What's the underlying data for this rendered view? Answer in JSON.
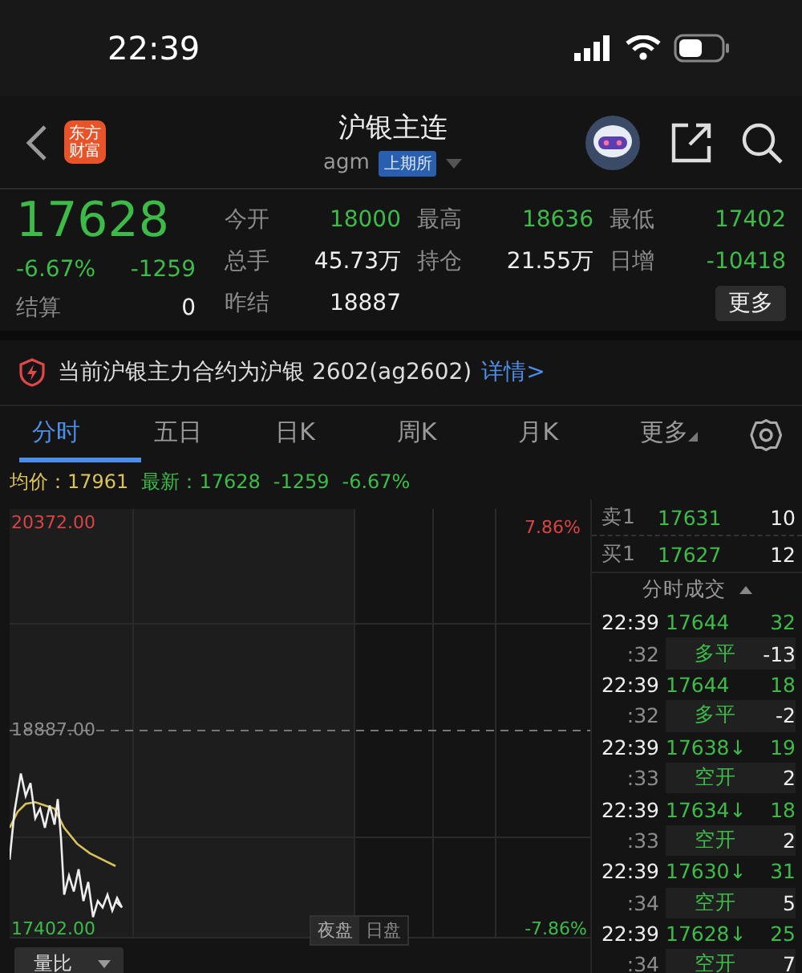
{
  "status_bar": {
    "time": "22:39"
  },
  "header": {
    "logo_lines": [
      "东方",
      "财富"
    ],
    "title": "沪银主连",
    "code": "agm",
    "exchange": "上期所"
  },
  "quote": {
    "price": "17628",
    "change_pct": "-6.67%",
    "change": "-1259",
    "settle_label": "结算",
    "settle": "0",
    "stats": [
      {
        "label": "今开",
        "value": "18000",
        "kind": "price"
      },
      {
        "label": "最高",
        "value": "18636",
        "kind": "price"
      },
      {
        "label": "最低",
        "value": "17402",
        "kind": "price"
      },
      {
        "label": "总手",
        "value": "45.73万",
        "kind": "plain"
      },
      {
        "label": "持仓",
        "value": "21.55万",
        "kind": "plain"
      },
      {
        "label": "日增",
        "value": "-10418",
        "kind": "price"
      },
      {
        "label": "昨结",
        "value": "18887",
        "kind": "plain"
      }
    ],
    "more_button": "更多"
  },
  "notice": {
    "text": "当前沪银主力合约为沪银 2602(ag2602)",
    "link": "详情>"
  },
  "tabs": [
    {
      "label": "分时",
      "selected": true,
      "kind": "tab"
    },
    {
      "label": "五日",
      "selected": false,
      "kind": "tab"
    },
    {
      "label": "日K",
      "selected": false,
      "kind": "tab"
    },
    {
      "label": "周K",
      "selected": false,
      "kind": "tab"
    },
    {
      "label": "月K",
      "selected": false,
      "kind": "tab"
    },
    {
      "label": "更多",
      "selected": false,
      "kind": "dropdown"
    }
  ],
  "info_line": {
    "avg_label": "均价：",
    "avg": "17961",
    "latest_label": "最新：",
    "latest": "17628",
    "change": "-1259",
    "change_pct": "-6.67%"
  },
  "chart": {
    "price_high": "20372.00",
    "prev_settle": "18887.00",
    "price_low": "17402.00",
    "pct_high": "7.86%",
    "pct_low": "-7.86%",
    "sessions": [
      {
        "label": "夜盘",
        "selected": true
      },
      {
        "label": "日盘",
        "selected": false
      }
    ]
  },
  "indicator": {
    "label": "量比"
  },
  "order_book": [
    {
      "label": "卖1",
      "price": "17631",
      "volume": "10"
    },
    {
      "label": "买1",
      "price": "17627",
      "volume": "12"
    }
  ],
  "trades": {
    "title": "分时成交",
    "rows": [
      {
        "time": "22:39",
        "price": "17644",
        "volume": "32",
        "seconds": ":32",
        "action": "多平",
        "action_volume": "-13"
      },
      {
        "time": "22:39",
        "price": "17644",
        "volume": "18",
        "seconds": ":32",
        "action": "多平",
        "action_volume": "-2"
      },
      {
        "time": "22:39",
        "price": "17638↓",
        "volume": "19",
        "seconds": ":33",
        "action": "空开",
        "action_volume": "2"
      },
      {
        "time": "22:39",
        "price": "17634↓",
        "volume": "18",
        "seconds": ":33",
        "action": "空开",
        "action_volume": "2"
      },
      {
        "time": "22:39",
        "price": "17630↓",
        "volume": "31",
        "seconds": ":34",
        "action": "空开",
        "action_volume": "5"
      },
      {
        "time": "22:39",
        "price": "17628↓",
        "volume": "25",
        "seconds": ":34",
        "action": "空开",
        "action_volume": "7"
      }
    ]
  }
}
